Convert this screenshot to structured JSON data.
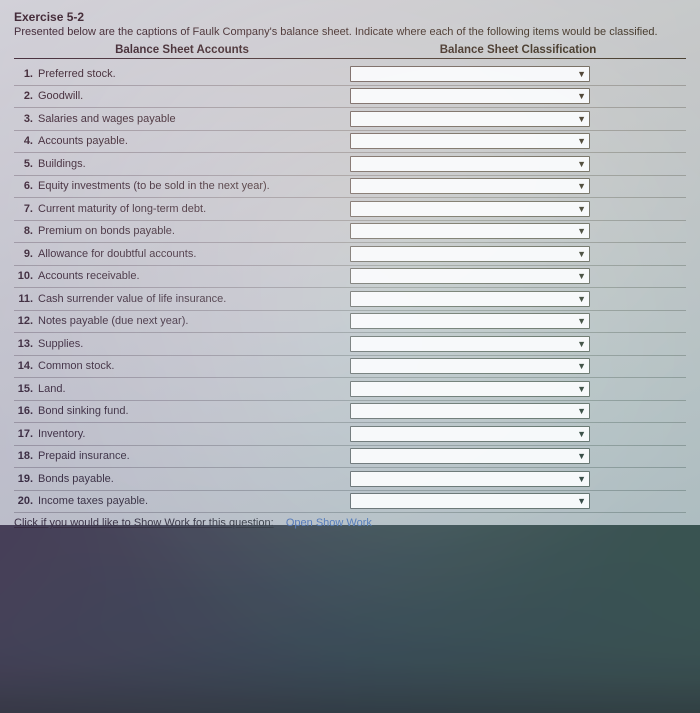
{
  "title": "Exercise 5-2",
  "prompt": "Presented below are the captions of Faulk Company's balance sheet. Indicate where each of the following items would be classified.",
  "headers": {
    "left": "Balance Sheet Accounts",
    "right": "Balance Sheet Classification"
  },
  "items": [
    {
      "n": "1.",
      "label": "Preferred stock."
    },
    {
      "n": "2.",
      "label": "Goodwill."
    },
    {
      "n": "3.",
      "label": "Salaries and wages payable"
    },
    {
      "n": "4.",
      "label": "Accounts payable."
    },
    {
      "n": "5.",
      "label": "Buildings."
    },
    {
      "n": "6.",
      "label": "Equity investments (to be sold in the next year)."
    },
    {
      "n": "7.",
      "label": "Current maturity of long-term debt."
    },
    {
      "n": "8.",
      "label": "Premium on bonds payable."
    },
    {
      "n": "9.",
      "label": "Allowance for doubtful accounts."
    },
    {
      "n": "10.",
      "label": "Accounts receivable."
    },
    {
      "n": "11.",
      "label": "Cash surrender value of life insurance."
    },
    {
      "n": "12.",
      "label": "Notes payable (due next year)."
    },
    {
      "n": "13.",
      "label": "Supplies."
    },
    {
      "n": "14.",
      "label": "Common stock."
    },
    {
      "n": "15.",
      "label": "Land."
    },
    {
      "n": "16.",
      "label": "Bond sinking fund."
    },
    {
      "n": "17.",
      "label": "Inventory."
    },
    {
      "n": "18.",
      "label": "Prepaid insurance."
    },
    {
      "n": "19.",
      "label": "Bonds payable."
    },
    {
      "n": "20.",
      "label": "Income taxes payable."
    }
  ],
  "footer": {
    "lead": "Click if you would like to Show Work for this question:",
    "link": "Open Show Work"
  }
}
